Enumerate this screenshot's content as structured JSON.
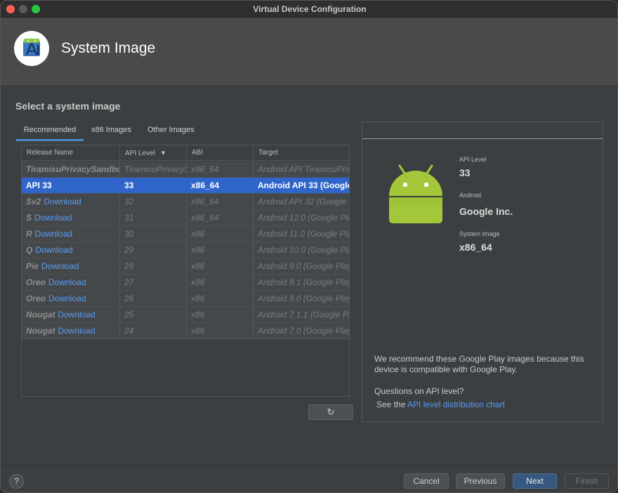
{
  "window": {
    "title": "Virtual Device Configuration"
  },
  "header": {
    "title": "System Image",
    "icon": "android-studio-icon"
  },
  "section_title": "Select a system image",
  "tabs": [
    {
      "label": "Recommended",
      "active": true
    },
    {
      "label": "x86 Images",
      "active": false
    },
    {
      "label": "Other Images",
      "active": false
    }
  ],
  "table": {
    "columns": [
      "Release Name",
      "API Level",
      "ABI",
      "Target"
    ],
    "sort_indicator": "▾",
    "rows": [
      {
        "name": "TiramisuPrivacySandbo",
        "download": "",
        "api": "TiramisuPrivacyS",
        "abi": "x86_64",
        "target": "Android API TiramisuPriv",
        "selected": false
      },
      {
        "name": "API 33",
        "download": "",
        "api": "33",
        "abi": "x86_64",
        "target": "Android API 33 (Google Pl",
        "selected": true
      },
      {
        "name": "Sv2",
        "download": "Download",
        "api": "32",
        "abi": "x86_64",
        "target": "Android API 32 (Google Play",
        "selected": false
      },
      {
        "name": "S",
        "download": "Download",
        "api": "31",
        "abi": "x86_64",
        "target": "Android 12.0 (Google Play",
        "selected": false
      },
      {
        "name": "R",
        "download": "Download",
        "api": "30",
        "abi": "x86",
        "target": "Android 11.0 (Google Play",
        "selected": false
      },
      {
        "name": "Q",
        "download": "Download",
        "api": "29",
        "abi": "x86",
        "target": "Android 10.0 (Google Play",
        "selected": false
      },
      {
        "name": "Pie",
        "download": "Download",
        "api": "28",
        "abi": "x86",
        "target": "Android 9.0 (Google Play",
        "selected": false
      },
      {
        "name": "Oreo",
        "download": "Download",
        "api": "27",
        "abi": "x86",
        "target": "Android 8.1 (Google Play",
        "selected": false
      },
      {
        "name": "Oreo",
        "download": "Download",
        "api": "26",
        "abi": "x86",
        "target": "Android 8.0 (Google Play",
        "selected": false
      },
      {
        "name": "Nougat",
        "download": "Download",
        "api": "25",
        "abi": "x86",
        "target": "Android 7.1.1 (Google Play",
        "selected": false
      },
      {
        "name": "Nougat",
        "download": "Download",
        "api": "24",
        "abi": "x86",
        "target": "Android 7.0 (Google Play",
        "selected": false
      }
    ]
  },
  "refresh": {
    "icon": "refresh-icon",
    "glyph": "↻"
  },
  "detail": {
    "api_label": "API Level",
    "api_value": "33",
    "vendor_label": "Android",
    "vendor_value": "Google Inc.",
    "image_label": "System Image",
    "image_value": "x86_64",
    "recommend_text": "We recommend these Google Play images because this device is compatible with Google Play.",
    "questions": "Questions on API level?",
    "see_the": "See the",
    "link_text": "API level distribution chart"
  },
  "footer": {
    "help": "?",
    "cancel": "Cancel",
    "previous": "Previous",
    "next": "Next",
    "finish": "Finish"
  },
  "colors": {
    "accent": "#2f65ca",
    "link": "#589df6",
    "android_green": "#a4c639"
  }
}
